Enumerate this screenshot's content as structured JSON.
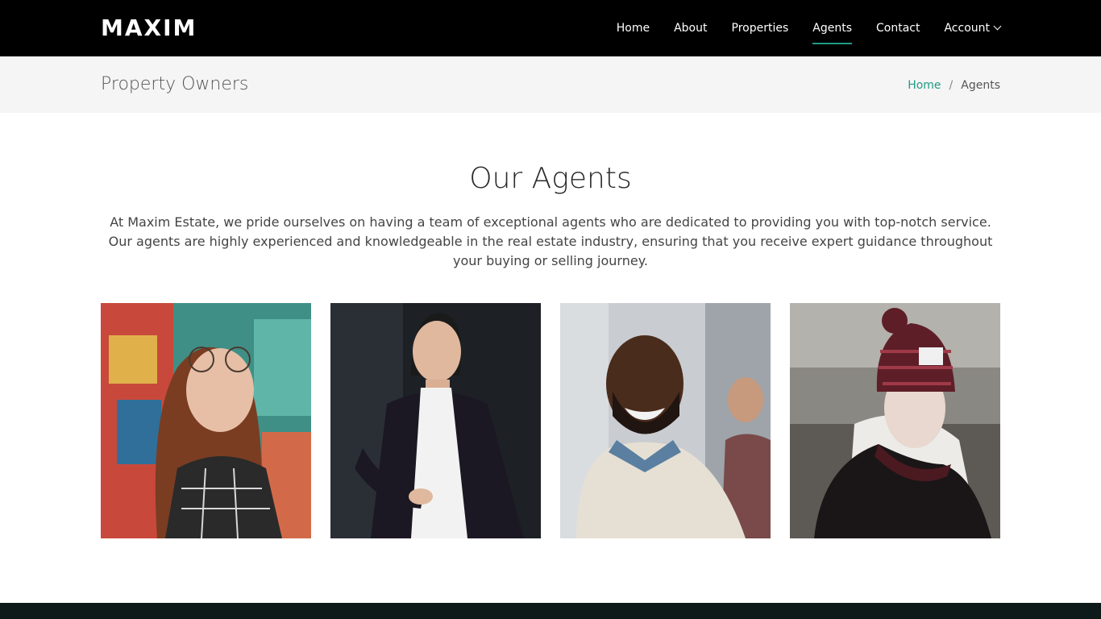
{
  "brand": "MAXIM",
  "nav": {
    "items": [
      {
        "label": "Home"
      },
      {
        "label": "About"
      },
      {
        "label": "Properties"
      },
      {
        "label": "Agents"
      },
      {
        "label": "Contact"
      },
      {
        "label": "Account"
      }
    ],
    "active": "Agents"
  },
  "header": {
    "title": "Property Owners",
    "breadcrumb": {
      "home": "Home",
      "separator": "/",
      "current": "Agents"
    }
  },
  "section": {
    "title": "Our Agents",
    "description": "At Maxim Estate, we pride ourselves on having a team of exceptional agents who are dedicated to providing you with top-notch service. Our agents are highly experienced and knowledgeable in the real estate industry, ensuring that you receive expert guidance throughout your buying or selling journey."
  },
  "colors": {
    "accent": "#1e9b85",
    "navbar": "#000000",
    "header_band": "#f5f5f5",
    "footer": "#0e1a1a"
  }
}
